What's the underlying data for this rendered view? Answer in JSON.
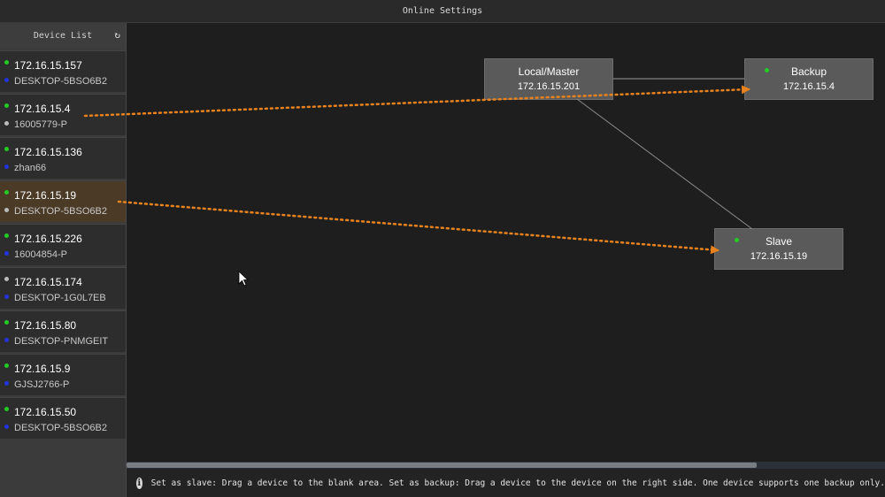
{
  "window": {
    "title": "Online Settings"
  },
  "sidebar": {
    "title": "Device List",
    "refresh_icon": "refresh-icon",
    "items": [
      {
        "ip": "172.16.15.157",
        "host": "DESKTOP-5BSO6B2",
        "status_top": "#22cc22",
        "status_bottom": "#2233dd",
        "selected": false
      },
      {
        "ip": "172.16.15.4",
        "host": "16005779-P",
        "status_top": "#22cc22",
        "status_bottom": "#bbbbbb",
        "selected": false
      },
      {
        "ip": "172.16.15.136",
        "host": "zhan66",
        "status_top": "#22cc22",
        "status_bottom": "#2233dd",
        "selected": false
      },
      {
        "ip": "172.16.15.19",
        "host": "DESKTOP-5BSO6B2",
        "status_top": "#22cc22",
        "status_bottom": "#bbbbbb",
        "selected": true
      },
      {
        "ip": "172.16.15.226",
        "host": "16004854-P",
        "status_top": "#22cc22",
        "status_bottom": "#2233dd",
        "selected": false
      },
      {
        "ip": "172.16.15.174",
        "host": "DESKTOP-1G0L7EB",
        "status_top": "#bbbbbb",
        "status_bottom": "#2233dd",
        "selected": false
      },
      {
        "ip": "172.16.15.80",
        "host": "DESKTOP-PNMGEIT",
        "status_top": "#22cc22",
        "status_bottom": "#2233dd",
        "selected": false
      },
      {
        "ip": "172.16.15.9",
        "host": "GJSJ2766-P",
        "status_top": "#22cc22",
        "status_bottom": "#2233dd",
        "selected": false
      },
      {
        "ip": "172.16.15.50",
        "host": "DESKTOP-5BSO6B2",
        "status_top": "#22cc22",
        "status_bottom": "#2233dd",
        "selected": false
      }
    ]
  },
  "topology": {
    "master": {
      "role": "Local/Master",
      "ip": "172.16.15.201"
    },
    "backup": {
      "role": "Backup",
      "ip": "172.16.15.4",
      "status": "#22cc22"
    },
    "slave": {
      "role": "Slave",
      "ip": "172.16.15.19",
      "status": "#22cc22"
    }
  },
  "hint": {
    "icon": "info-icon",
    "text": "Set as slave: Drag a device to the blank area. Set as backup: Drag a device to the device on the right side. One device supports one backup only."
  },
  "colors": {
    "accent_arrow": "#e8821e",
    "selected_row": "#4a3a26",
    "online": "#22cc22"
  }
}
